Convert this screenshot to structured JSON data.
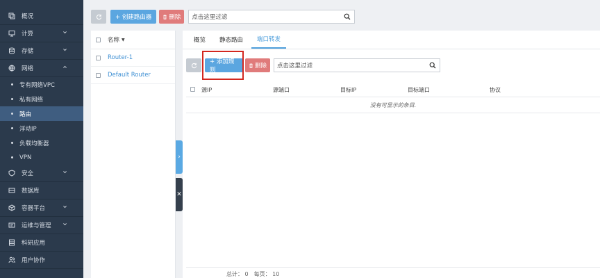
{
  "sidebar": {
    "items": [
      {
        "label": "概况",
        "icon": "overview-icon"
      },
      {
        "label": "计算",
        "icon": "monitor-icon",
        "expandable": true
      },
      {
        "label": "存储",
        "icon": "database-icon",
        "expandable": true
      },
      {
        "label": "网络",
        "icon": "network-icon",
        "expanded": true
      }
    ],
    "network_sub": [
      {
        "label": "专有网络VPC"
      },
      {
        "label": "私有网络"
      },
      {
        "label": "路由",
        "active": true
      },
      {
        "label": "浮动IP"
      },
      {
        "label": "负载均衡器"
      },
      {
        "label": "VPN"
      }
    ],
    "items_after": [
      {
        "label": "安全",
        "icon": "shield-icon",
        "expandable": true
      },
      {
        "label": "数据库",
        "icon": "db-icon"
      },
      {
        "label": "容器平台",
        "icon": "container-icon",
        "expandable": true
      },
      {
        "label": "运维与管理",
        "icon": "ops-icon",
        "expandable": true
      },
      {
        "label": "科研应用",
        "icon": "research-icon"
      },
      {
        "label": "用户协作",
        "icon": "users-icon"
      }
    ]
  },
  "toolbar": {
    "create_label": "+ 创建路由器",
    "delete_label": "删除",
    "search_placeholder": "点击这里过滤"
  },
  "list": {
    "header": "名称",
    "rows": [
      "Router-1",
      "Default Router"
    ]
  },
  "detail": {
    "tabs": [
      "概览",
      "静态路由",
      "端口转发"
    ],
    "active_tab": "端口转发",
    "add_rule_label": "+ 添加规则",
    "delete_label": "删除",
    "search_placeholder": "点击这里过滤",
    "columns": [
      "源IP",
      "源端口",
      "目标IP",
      "目标端口",
      "协议"
    ],
    "empty_text": "没有可显示的条目.",
    "footer": {
      "total": "总计： 0",
      "per_page": "每页： 10"
    }
  }
}
